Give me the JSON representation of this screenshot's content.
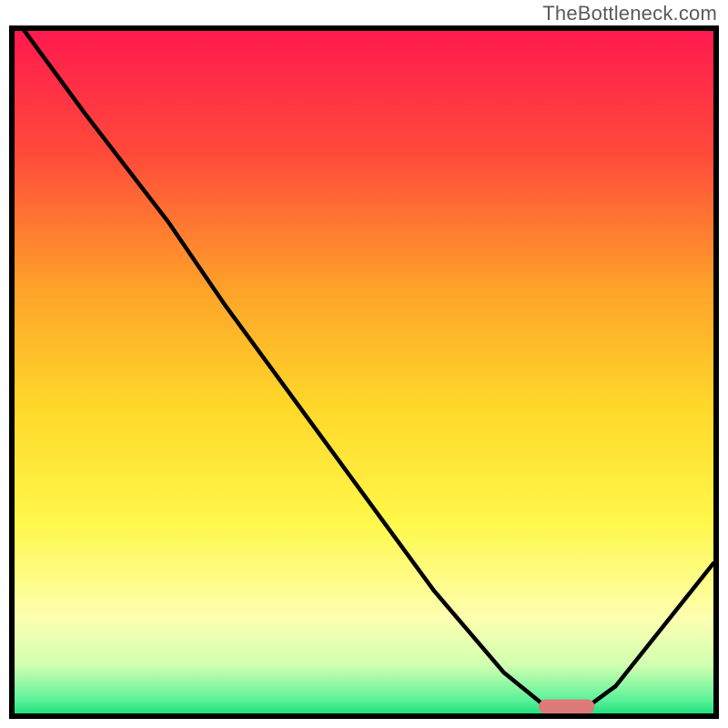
{
  "watermark": "TheBottleneck.com",
  "chart_data": {
    "type": "line",
    "title": "",
    "xlabel": "",
    "ylabel": "",
    "xlim": [
      0,
      100
    ],
    "ylim": [
      0,
      100
    ],
    "x": [
      0,
      10,
      22,
      30,
      40,
      50,
      60,
      70,
      76,
      82,
      86,
      100
    ],
    "values": [
      102,
      88,
      72,
      60,
      46,
      32,
      18,
      6,
      1,
      1,
      4,
      22
    ],
    "minimum_marker": {
      "x_center": 79,
      "y": 1,
      "color": "#dd7a7a",
      "width": 8
    },
    "gradient_stops": [
      {
        "offset": 0.0,
        "color": "#ff1a4f"
      },
      {
        "offset": 0.18,
        "color": "#ff4a3a"
      },
      {
        "offset": 0.38,
        "color": "#ffa329"
      },
      {
        "offset": 0.55,
        "color": "#ffd829"
      },
      {
        "offset": 0.72,
        "color": "#fff84a"
      },
      {
        "offset": 0.86,
        "color": "#fdffb0"
      },
      {
        "offset": 0.93,
        "color": "#d0ffb0"
      },
      {
        "offset": 0.98,
        "color": "#5cf29a"
      },
      {
        "offset": 1.0,
        "color": "#22e07a"
      }
    ]
  }
}
